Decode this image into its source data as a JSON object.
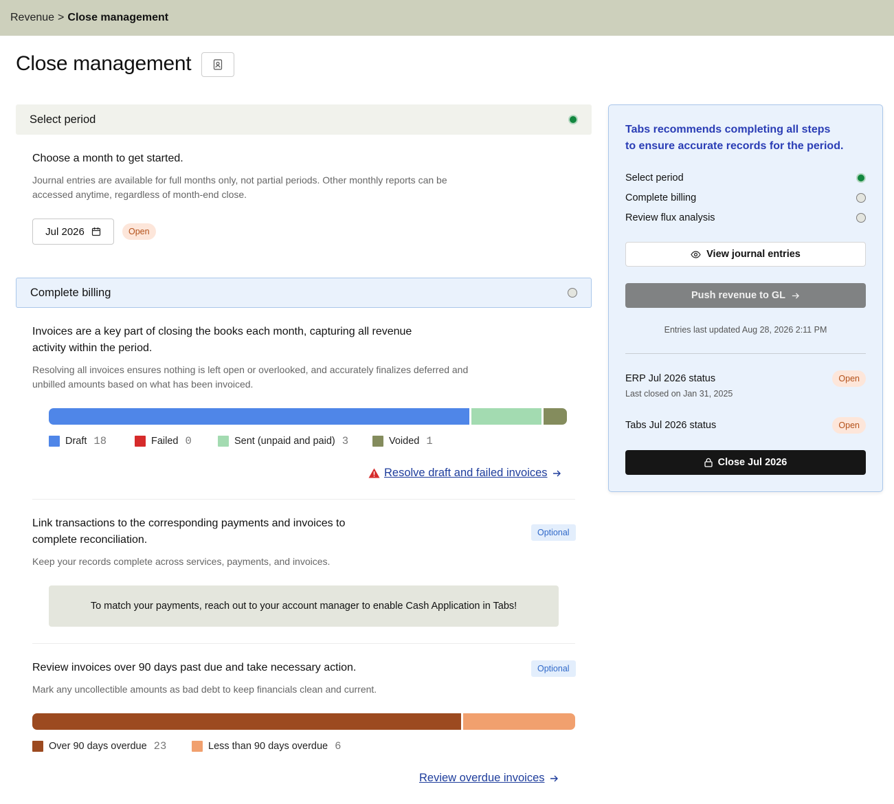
{
  "breadcrumb": {
    "root": "Revenue",
    "separator": ">",
    "current": "Close management"
  },
  "page": {
    "title": "Close management",
    "title_icon": "contact-book-icon"
  },
  "sections": {
    "period": {
      "header": "Select period",
      "status": "complete",
      "heading": "Choose a month to get started.",
      "desc_line1": "Journal entries are available for full months only, not partial periods. Other monthly reports can be",
      "desc_line2": "accessed anytime, regardless of month-end close.",
      "month": "Jul 2026",
      "month_status": "Open"
    },
    "billing": {
      "header": "Complete billing",
      "status": "incomplete",
      "invoices": {
        "heading_line1": "Invoices are a key part of closing the books each month, capturing all revenue",
        "heading_line2": "activity within the period.",
        "desc_line1": "Resolving all invoices ensures nothing is left open or overlooked, and accurately finalizes deferred and",
        "desc_line2": "unbilled amounts based on what has been invoiced.",
        "legend": [
          {
            "label": "Draft",
            "count": 18,
            "color": "#4f86e8"
          },
          {
            "label": "Failed",
            "count": 0,
            "color": "#d62b2b"
          },
          {
            "label": "Sent (unpaid and paid)",
            "count": 3,
            "color": "#a3dbb1"
          },
          {
            "label": "Voided",
            "count": 1,
            "color": "#848c5d"
          }
        ],
        "action": "Resolve draft and failed invoices"
      },
      "reconciliation": {
        "heading_line1": "Link transactions to the corresponding payments and invoices to",
        "heading_line2": "complete reconciliation.",
        "badge": "Optional",
        "desc": "Keep your records complete across services, payments, and invoices.",
        "notice": "To match your payments, reach out to your account manager to enable Cash Application in Tabs!"
      },
      "overdue": {
        "heading": "Review invoices over 90 days past due and take necessary action.",
        "badge": "Optional",
        "desc": "Mark any uncollectible amounts as bad debt to keep financials clean and current.",
        "legend": [
          {
            "label": "Over 90 days overdue",
            "count": 23,
            "color": "#9c4a20"
          },
          {
            "label": "Less than 90 days overdue",
            "count": 6,
            "color": "#f1a06e"
          }
        ],
        "action": "Review overdue invoices"
      }
    }
  },
  "panel": {
    "title_line1": "Tabs recommends completing all steps",
    "title_line2": "to ensure accurate records for the period.",
    "steps": [
      {
        "label": "Select period",
        "done": true
      },
      {
        "label": "Complete billing",
        "done": false
      },
      {
        "label": "Review flux analysis",
        "done": false
      }
    ],
    "view_journal": "View journal entries",
    "push_revenue": "Push revenue to GL",
    "updated": "Entries last updated Aug 28, 2026 2:11 PM",
    "erp_status_label": "ERP Jul 2026 status",
    "erp_status": "Open",
    "erp_last_closed": "Last closed on Jan 31, 2025",
    "tabs_status_label": "Tabs Jul 2026 status",
    "tabs_status": "Open",
    "close_button": "Close Jul 2026"
  }
}
